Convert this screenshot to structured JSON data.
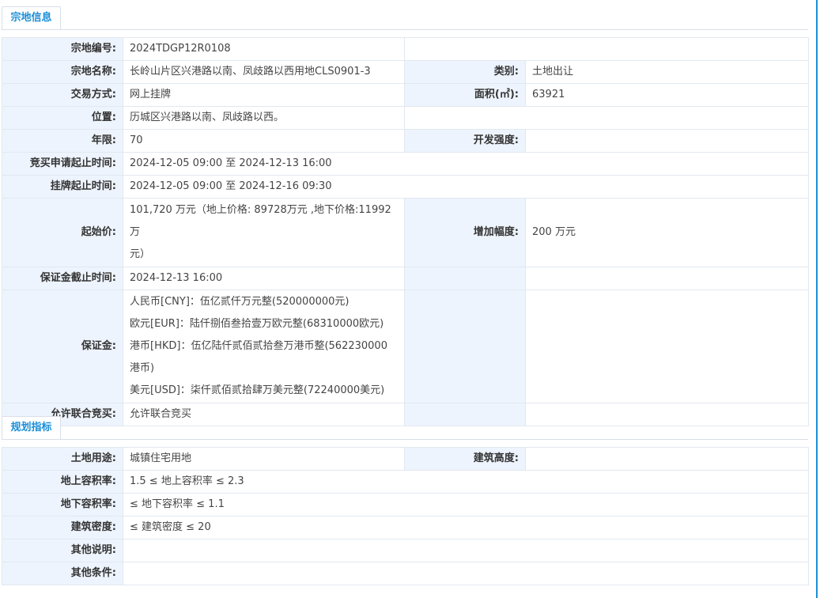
{
  "section1": {
    "title": "宗地信息",
    "rows": {
      "parcel_no_label": "宗地编号:",
      "parcel_no_value": "2024TDGP12R0108",
      "parcel_name_label": "宗地名称:",
      "parcel_name_value": "长岭山片区兴港路以南、凤歧路以西用地CLS0901-3",
      "category_label": "类别:",
      "category_value": "土地出让",
      "trade_method_label": "交易方式:",
      "trade_method_value": "网上挂牌",
      "area_label": "面积(㎡):",
      "area_value": "63921",
      "location_label": "位置:",
      "location_value": "历城区兴港路以南、凤歧路以西。",
      "term_label": "年限:",
      "term_value": "70",
      "dev_intensity_label": "开发强度:",
      "dev_intensity_value": "",
      "bid_apply_label": "竞买申请起止时间:",
      "bid_apply_value": "2024-12-05 09:00 至 2024-12-13 16:00",
      "listing_label": "挂牌起止时间:",
      "listing_value": "2024-12-05 09:00 至 2024-12-16 09:30",
      "start_price_label": "起始价:",
      "start_price_line1": "101,720 万元（地上价格: 89728万元 ,地下价格:11992万",
      "start_price_line2": "元）",
      "increment_label": "增加幅度:",
      "increment_value": "200 万元",
      "deposit_deadline_label": "保证金截止时间:",
      "deposit_deadline_value": "2024-12-13 16:00",
      "deposit_label": "保证金:",
      "deposit_lines": [
        "人民币[CNY]：伍亿贰仟万元整(520000000元)",
        "欧元[EUR]：陆仟捌佰叁拾壹万欧元整(68310000欧元)",
        "港币[HKD]：伍亿陆仟贰佰贰拾叁万港币整(562230000",
        "港币)",
        "美元[USD]：柒仟贰佰贰拾肆万美元整(72240000美元)"
      ],
      "joint_bid_label": "允许联合竞买:",
      "joint_bid_value": "允许联合竞买"
    }
  },
  "section2": {
    "title": "规划指标",
    "rows": {
      "land_use_label": "土地用途:",
      "land_use_value": "城镇住宅用地",
      "building_height_label": "建筑高度:",
      "building_height_value": "",
      "far_above_label": "地上容积率:",
      "far_above_value": "1.5 ≤ 地上容积率 ≤ 2.3",
      "far_below_label": "地下容积率:",
      "far_below_value": "≤ 地下容积率 ≤ 1.1",
      "density_label": "建筑密度:",
      "density_value": "≤ 建筑密度 ≤ 20",
      "other_notes_label": "其他说明:",
      "other_notes_value": "",
      "other_conditions_label": "其他条件:",
      "other_conditions_value": ""
    }
  },
  "colors": {
    "accent": "#1b8fd8",
    "label_bg": "#eef4fd",
    "border": "#e2e8f0"
  }
}
